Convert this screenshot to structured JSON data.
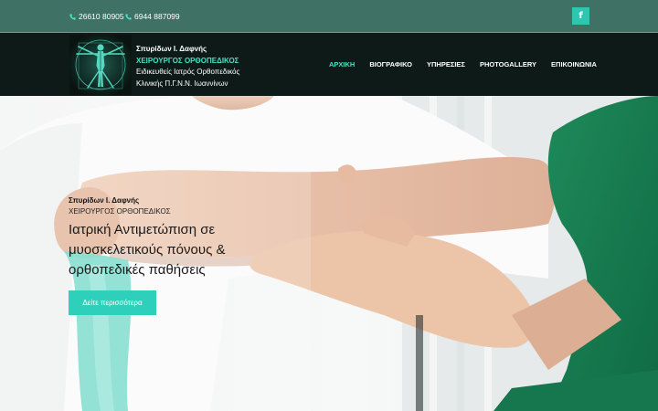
{
  "topbar": {
    "phone_1": "26610 80905",
    "phone_2": "6944 887099",
    "social_icon": "facebook-icon"
  },
  "brand": {
    "name": "Σπυρίδων Ι. Δαφνής",
    "title": "ΧΕΙΡΟΥΡΓΟΣ ΟΡΘΟΠΕΔΙΚΟΣ",
    "line_1": "Ειδικευθείς Ιατρός Ορθοπεδικός",
    "line_2": "Κλινικής Π.Γ.Ν.Ν. Ιωαννίνων"
  },
  "nav": {
    "items": [
      {
        "label": "ΑΡΧΙΚΗ",
        "active": true
      },
      {
        "label": "ΒΙΟΓΡΑΦΙΚΟ",
        "active": false
      },
      {
        "label": "ΥΠΗΡΕΣΙΕΣ",
        "active": false
      },
      {
        "label": "PHOTOGALLERY",
        "active": false
      },
      {
        "label": "ΕΠΙΚΟΙΝΩΝΙΑ",
        "active": false
      }
    ]
  },
  "hero": {
    "name": "Σπυρίδων Ι. Δαφνής",
    "role": "ΧΕΙΡΟΥΡΓΟΣ ΟΡΘΟΠΕΔΙΚΟΣ",
    "heading_line_1": "Ιατρική Αντιμετώπιση σε",
    "heading_line_2": "μυοσκελετικούς πόνους &",
    "heading_line_3": "ορθοπεδικές παθήσεις",
    "cta_label": "Δείτε περισσότερα"
  },
  "colors": {
    "topbar_bg": "#3f7265",
    "header_bg": "#0e1a18",
    "accent": "#2fd0bb",
    "accent_text": "#49e0c4"
  }
}
